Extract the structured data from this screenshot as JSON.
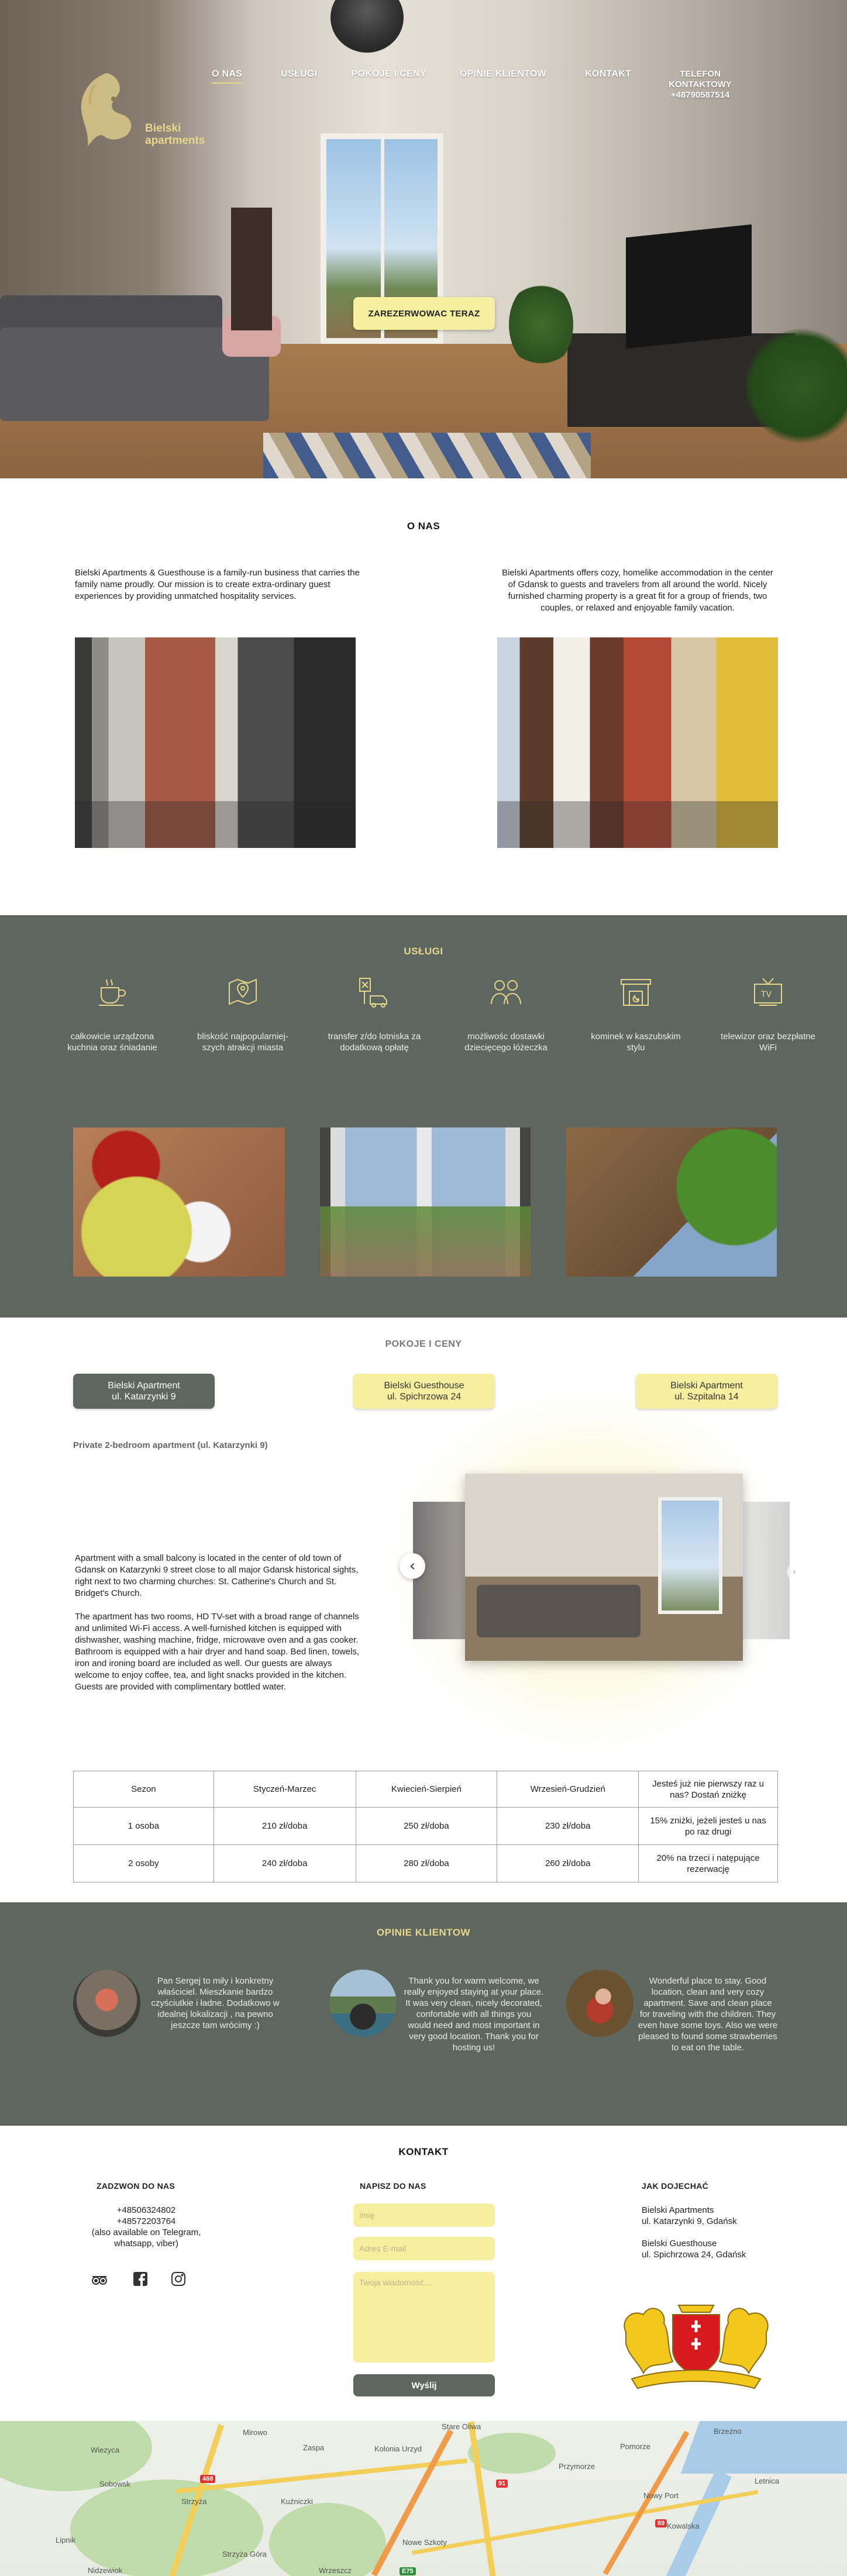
{
  "nav": {
    "brand_line1": "Bielski",
    "brand_line2": "apartments",
    "items": [
      "O NAS",
      "USŁUGI",
      "POKOJE I CENY",
      "OPINIE KLIENTOW",
      "KONTAKT"
    ],
    "contact_line1": "TELEFON",
    "contact_line2": "KONTAKTOWY",
    "contact_line3": "+48790587514",
    "active_color": "#e7d78a"
  },
  "hero": {
    "cta": "ZAREZERWOWAC TERAZ"
  },
  "about": {
    "title": "O NAS",
    "left_text": "Bielski Apartments & Guesthouse is a family-run business that carries the family name proudly.  Our mission is to create extra-ordinary guest experiences by providing unmatched hospitality services.",
    "right_text": "Bielski Apartments offers cozy, homelike accommodation in the center of Gdansk to guests and travelers from all around the world. Nicely furnished charming property is a great fit for a group of friends, two couples, or relaxed and enjoyable family vacation."
  },
  "services": {
    "title": "USŁUGI",
    "items": [
      {
        "icon": "coffee-cup-icon",
        "label": "całkowicie urządzona kuchnia oraz śniadanie"
      },
      {
        "icon": "map-pin-icon",
        "label": "bliskość najpopularniej-szych atrakcji miasta"
      },
      {
        "icon": "airport-transfer-icon",
        "label": "transfer z/do lotniska za dodatkową opłatę"
      },
      {
        "icon": "family-icon",
        "label": "możliwośc dostawki dziecięcego łóżeczka"
      },
      {
        "icon": "fireplace-icon",
        "label": "kominek w kaszubskim stylu"
      },
      {
        "icon": "tv-icon",
        "label": "telewizor oraz bezpłatne WiFi"
      }
    ]
  },
  "rooms": {
    "title": "POKOJE I CENY",
    "tabs": [
      {
        "line1": "Bielski Apartment",
        "line2": "ul. Katarzynki 9"
      },
      {
        "line1": "Bielski Guesthouse",
        "line2": "ul. Spichrzowa 24"
      },
      {
        "line1": "Bielski Apartment",
        "line2": "ul. Szpitalna 14"
      }
    ],
    "subtitle": "Private 2-bedroom apartment (ul. Katarzynki 9)",
    "desc_p1": "Apartment with a small balcony is located in the center of old town of Gdansk on Katarzynki 9 street close to all major Gdansk historical sights, right next to two charming churches: St. Catherine's Church and St. Bridget's Church.",
    "desc_p2": "The apartment has two rooms, HD TV-set with a broad range of channels and unlimited Wi-Fi access. A well-furnished kitchen is equipped with dishwasher, washing machine, fridge, microwave oven and a gas cooker. Bathroom is equipped with a hair dryer and  hand soap. Bed linen, towels, iron and ironing board are included as well. Our guests are always welcome to enjoy coffee, tea, and light snacks provided in the kitchen. Guests are provided with complimentary bottled water.",
    "prev_symbol": "‹",
    "next_symbol": "›",
    "table": {
      "headers": [
        "Sezon",
        "Styczeń-Marzec",
        "Kwiecień-Sierpień",
        "Wrzesień-Grudzień",
        "Jesteś już nie pierwszy raz u nas? Dostań zniżkę"
      ],
      "rows": [
        [
          "1 osoba",
          "210 zł/doba",
          "250 zł/doba",
          "230 zł/doba",
          "15% zniżki, jeżeli jesteś u nas po raz drugi"
        ],
        [
          "2 osoby",
          "240 zł/doba",
          "280 zł/doba",
          "260 zł/doba",
          "20% na trzeci i natępujące rezerwację"
        ]
      ]
    }
  },
  "reviews": {
    "title": "OPINIE KLIENTOW",
    "items": [
      "Pan Sergej to miły i konkretny właściciel. Mieszkanie bardzo czyściutkie i ładne. Dodatkowo w idealnej lokalizacji , na pewno jeszcze tam wrócimy :)",
      "Thank you for warm welcome, we really enjoyed staying at your place. It was very clean, nicely decorated, confortable with all things you would need and most important in very good location. Thank you for hosting us!",
      "Wonderful place to stay. Good location, clean and very cozy apartment. Save and clean place for traveling with the children. They even have some toys. Also we were pleased to found some strawberries to eat on the table."
    ]
  },
  "contact": {
    "title": "KONTAKT",
    "call_head": "ZADZWON DO NAS",
    "phone1": "+48506324802",
    "phone2": "+48572203764",
    "phone_note": "(also available on Telegram, whatsapp, viber)",
    "write_head": "NAPISZ DO NAS",
    "name_placeholder": "Imię",
    "email_placeholder": "Adres E-mail",
    "message_placeholder": "Twoja wiadomość....",
    "send_label": "Wyślij",
    "directions_head": "JAK DOJECHAĆ",
    "addr1_line1": "Bielski Apartments",
    "addr1_line2": "ul. Katarzynki 9, Gdańsk",
    "addr2_line1": "Bielski Guesthouse",
    "addr2_line2": "ul. Spichrzowa 24, Gdańsk"
  },
  "map": {
    "labels": [
      "Wiezyca",
      "Mirowo",
      "Zaspa",
      "Przymorze",
      "Pomorze",
      "Stare Oliwa",
      "Sobowsk",
      "Kolonia Urzyd",
      "Letnica",
      "Strzyża",
      "Kuźniczki",
      "Nowe Szkoty",
      "Strzyża Góra",
      "Wrzeszcz",
      "Brzeźno",
      "Nowy Port",
      "Kowalska",
      "Nidzewiok",
      "Lipnik"
    ],
    "route_numbers": [
      "468",
      "91",
      "89",
      "E75"
    ]
  }
}
